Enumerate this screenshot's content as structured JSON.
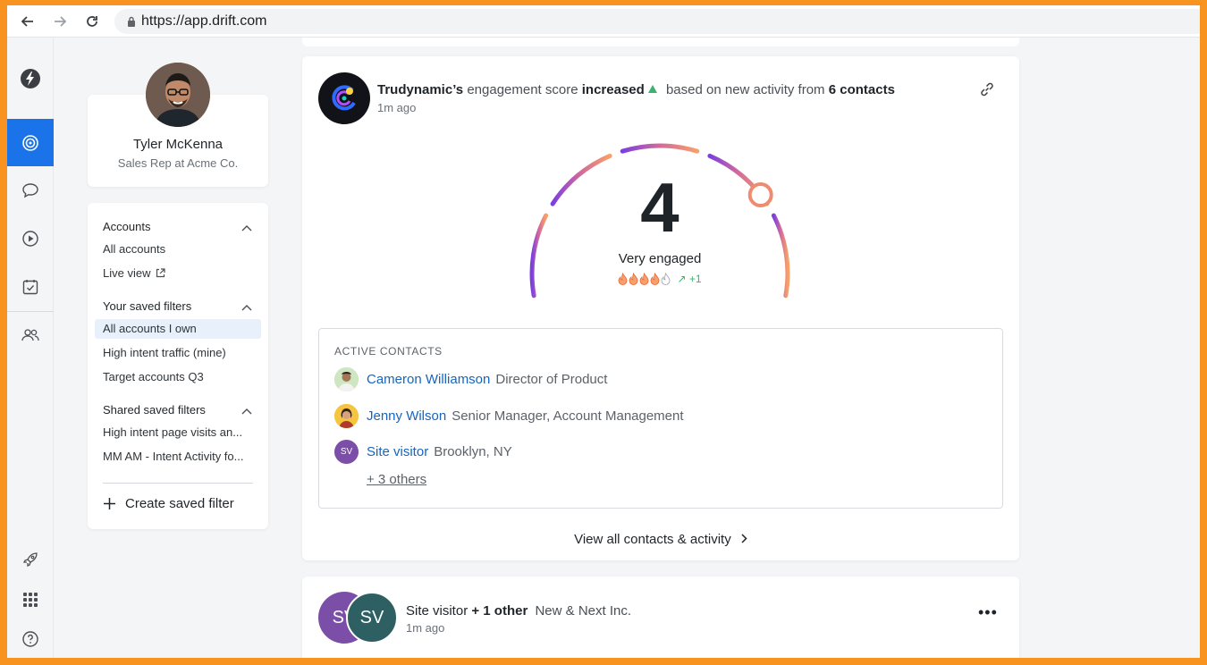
{
  "browser": {
    "url": "https://app.drift.com"
  },
  "left_nav": {
    "items": [
      "drift-logo-icon",
      "accounts-target-icon",
      "chat-icon",
      "video-play-icon",
      "calendar-check-icon",
      "contacts-icon",
      "rocket-icon",
      "apps-grid-icon",
      "help-icon"
    ],
    "accent_color": "#1a73e8"
  },
  "profile": {
    "name": "Tyler McKenna",
    "role": "Sales Rep at Acme Co."
  },
  "filters": {
    "accounts_heading": "Accounts",
    "all_accounts": "All accounts",
    "live_view": "Live view",
    "saved_heading": "Your saved filters",
    "saved_items": [
      "All accounts I own",
      "High intent traffic (mine)",
      "Target accounts Q3"
    ],
    "shared_heading": "Shared saved filters",
    "shared_items": [
      "High intent page visits an...",
      "MM AM - Intent Activity fo..."
    ],
    "create_label": "Create saved filter"
  },
  "engagement": {
    "company": "Trudynamic’s",
    "text_1": "engagement score",
    "status": "increased",
    "text_2": "based on new activity from",
    "contacts_count": "6 contacts",
    "time": "1m ago",
    "score": "4",
    "score_label": "Very engaged",
    "trend": "↗ +1",
    "level": {
      "filled": 4,
      "total": 5
    },
    "gauge_level_percent": 80
  },
  "active_contacts": {
    "title": "ACTIVE CONTACTS",
    "rows": [
      {
        "name": "Cameron Williamson",
        "role": "Director of Product",
        "initials": ""
      },
      {
        "name": "Jenny Wilson",
        "role": "Senior Manager, Account Management",
        "initials": ""
      },
      {
        "name": "Site visitor",
        "role": "Brooklyn, NY",
        "initials": "SV"
      }
    ],
    "others": "+ 3 others"
  },
  "view_all": "View all contacts & activity",
  "second_card": {
    "avatar_a": "SV",
    "avatar_b": "SV",
    "visitor": "Site visitor",
    "plus_other": "+ 1 other",
    "company": "New & Next Inc.",
    "time": "1m ago",
    "more": "•••"
  }
}
